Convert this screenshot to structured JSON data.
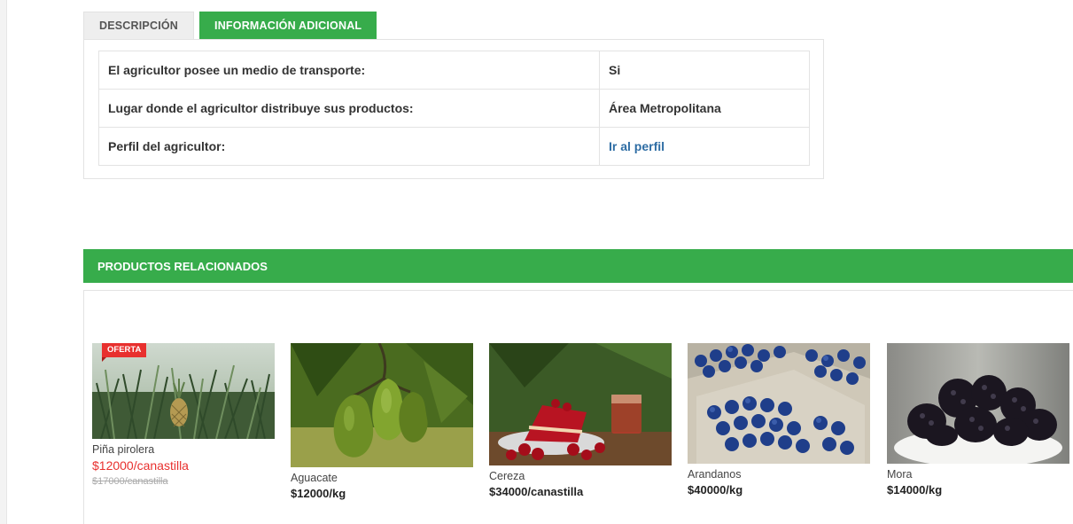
{
  "tabs": {
    "description": "DESCRIPCIÓN",
    "additional_info": "INFORMACIÓN ADICIONAL"
  },
  "info_table": {
    "rows": [
      {
        "label": "El agricultor posee un medio de transporte:",
        "value": "Si"
      },
      {
        "label": "Lugar donde el agricultor distribuye sus productos:",
        "value": "Área Metropolitana"
      },
      {
        "label": "Perfil del agricultor:",
        "value": "Ir al perfil"
      }
    ]
  },
  "related": {
    "title": "PRODUCTOS RELACIONADOS",
    "products": [
      {
        "name": "Piña pirolera",
        "price": "$12000/canastilla",
        "old_price": "$17000/canastilla",
        "badge": "OFERTA",
        "image": "pineapple-plant-photo"
      },
      {
        "name": "Aguacate",
        "price": "$12000/kg",
        "image": "avocado-photo"
      },
      {
        "name": "Cereza",
        "price": "$34000/canastilla",
        "image": "cherry-photo"
      },
      {
        "name": "Arandanos",
        "price": "$40000/kg",
        "image": "blueberry-photo"
      },
      {
        "name": "Mora",
        "price": "$14000/kg",
        "image": "blackberry-photo"
      }
    ]
  },
  "colors": {
    "brand_green": "#37ac4b",
    "sale_red": "#e8302e",
    "link_blue": "#2e6da4"
  }
}
